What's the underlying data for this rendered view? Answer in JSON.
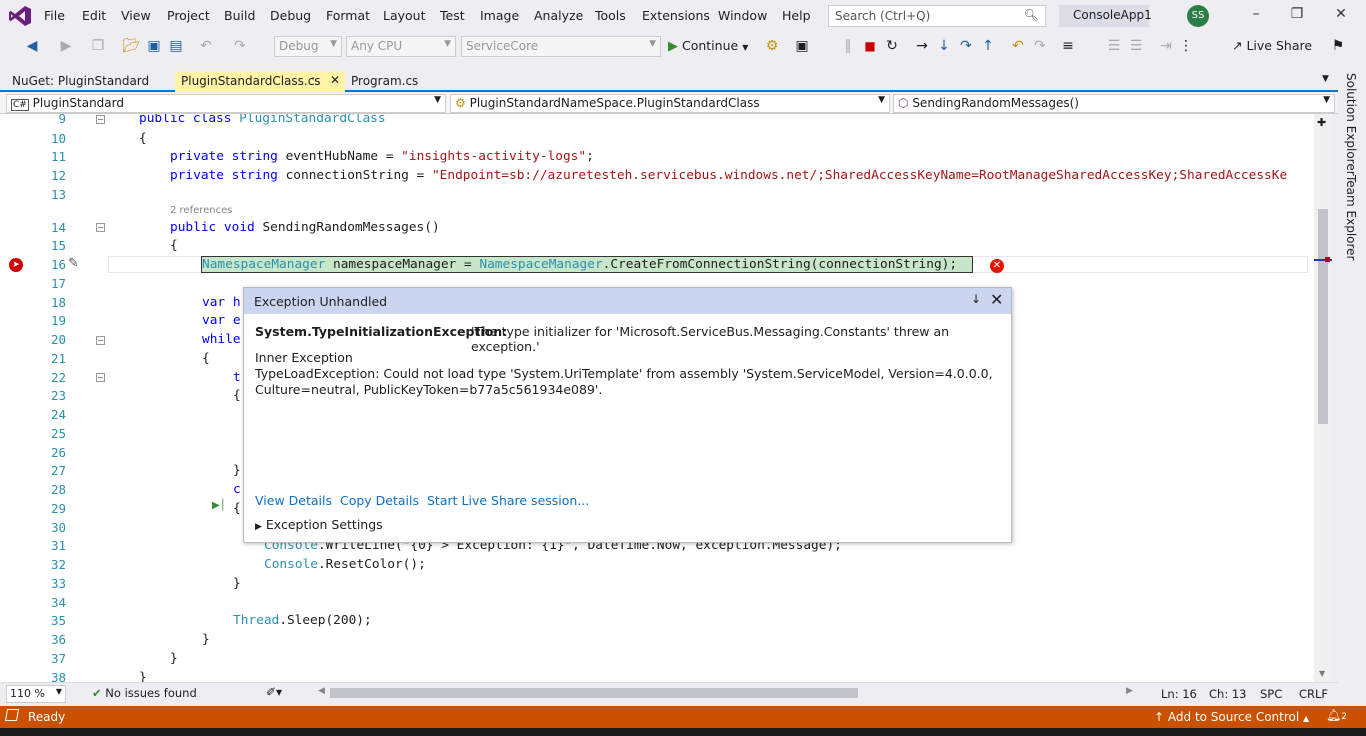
{
  "menu": {
    "items": [
      "File",
      "Edit",
      "View",
      "Project",
      "Build",
      "Debug",
      "Format",
      "Layout",
      "Test",
      "Image",
      "Analyze",
      "Tools",
      "Extensions",
      "Window",
      "Help"
    ],
    "search_placeholder": "Search (Ctrl+Q)",
    "project": "ConsoleApp1",
    "avatar": "SS"
  },
  "toolbar": {
    "config": "Debug",
    "platform": "Any CPU",
    "startup": "ServiceCore",
    "continue": "Continue",
    "live_share": "Live Share"
  },
  "tabs": [
    {
      "label": "NuGet: PluginStandard",
      "active": false
    },
    {
      "label": "PluginStandardClass.cs",
      "active": true
    },
    {
      "label": "Program.cs",
      "active": false
    }
  ],
  "navbar": {
    "project": "PluginStandard",
    "type": "PluginStandardNameSpace.PluginStandardClass",
    "member": "SendingRandomMessages()"
  },
  "code": {
    "line_numbers": [
      "9",
      "10",
      "11",
      "12",
      "13",
      "14",
      "15",
      "16",
      "17",
      "18",
      "19",
      "20",
      "21",
      "22",
      "23",
      "24",
      "25",
      "26",
      "27",
      "28",
      "29",
      "30",
      "31",
      "32",
      "33",
      "34",
      "35",
      "36",
      "37",
      "38"
    ],
    "codelens": "2 references",
    "lines": {
      "l9_kw": "public class ",
      "l9_ty": "PluginStandardClass",
      "l10": "{",
      "l11_kw": "private string ",
      "l11_name": "eventHubName = ",
      "l11_str": "\"insights-activity-logs\"",
      "l11_end": ";",
      "l12_kw": "private string ",
      "l12_name": "connectionString = ",
      "l12_str": "\"Endpoint=sb://azuretesteh.servicebus.windows.net/;SharedAccessKeyName=RootManageSharedAccessKey;SharedAccessKe",
      "l14_kw": "public void ",
      "l14_name": "SendingRandomMessages()",
      "l15": "{",
      "l16_ty": "NamespaceManager",
      "l16_mid": " namespaceManager = ",
      "l16_ty2": "NamespaceManager",
      "l16_rest": ".CreateFromConnectionString(connectionString);",
      "l18": "var h",
      "l19": "var e",
      "l20": "while",
      "l21": "{",
      "l22": "t",
      "l23": "{",
      "l27": "}",
      "l28": "c",
      "l29": "{",
      "l31_ty": "Console",
      "l31_rest": ".WriteLine(\"{0} > Exception: {1}\", DateTime.Now, exception.Message);",
      "l32_ty": "Console",
      "l32_rest": ".ResetColor();",
      "l33": "}",
      "l35_ty": "Thread",
      "l35_rest": ".Sleep(200);",
      "l36": "}",
      "l37": "}",
      "l38": "}"
    }
  },
  "exception": {
    "title": "Exception Unhandled",
    "type": "System.TypeInitializationException:",
    "message": "'The type initializer for 'Microsoft.ServiceBus.Messaging.Constants' threw an exception.'",
    "inner_label": "Inner Exception",
    "inner_message": "TypeLoadException: Could not load type 'System.UriTemplate' from assembly 'System.ServiceModel, Version=4.0.0.0, Culture=neutral, PublicKeyToken=b77a5c561934e089'.",
    "links": [
      "View Details",
      "Copy Details",
      "Start Live Share session..."
    ],
    "settings": "Exception Settings"
  },
  "side_panels": [
    "Solution Explorer",
    "Team Explorer"
  ],
  "bottom": {
    "zoom": "110 %",
    "issues": "No issues found",
    "line": "Ln: 16",
    "col": "Ch: 13",
    "spc": "SPC",
    "crlf": "CRLF"
  },
  "status": {
    "ready": "Ready",
    "source_control": "Add to Source Control",
    "notifications": "2"
  }
}
